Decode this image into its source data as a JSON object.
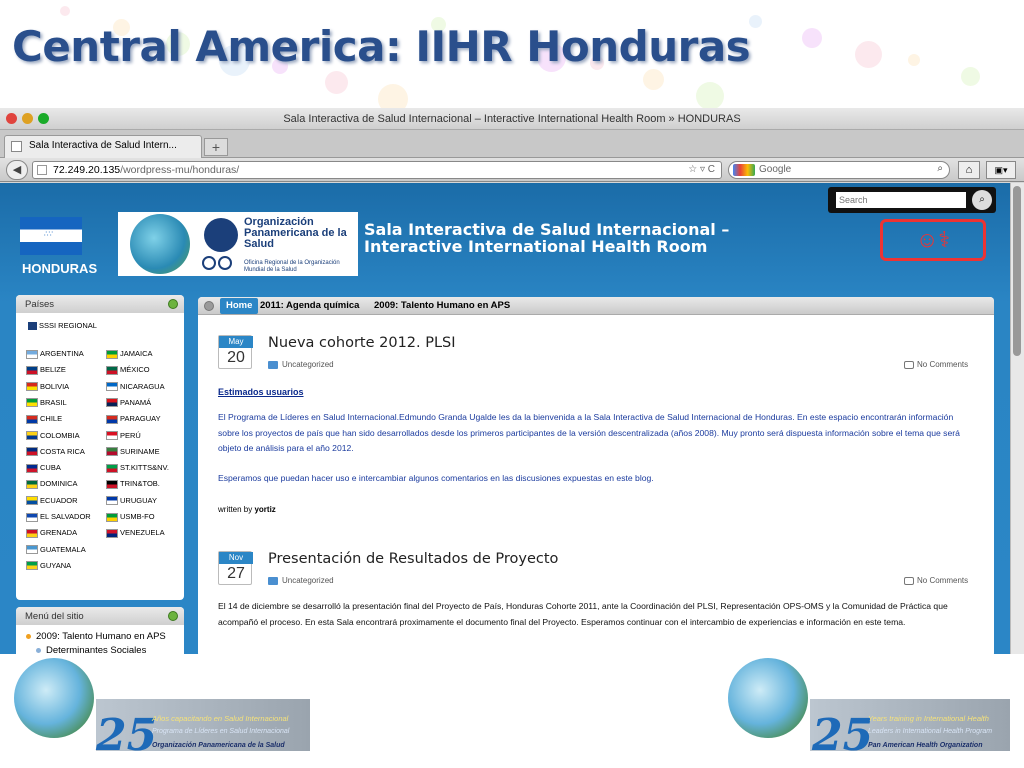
{
  "slide": {
    "title": "Central America: IIHR Honduras"
  },
  "window": {
    "title": "Sala Interactiva de Salud Internacional – Interactive International Health Room » HONDURAS",
    "tab_label": "Sala Interactiva de Salud Intern...",
    "new_tab_symbol": "+",
    "url_host": "72.249.20.135",
    "url_path": "/wordpress-mu/honduras/",
    "search_engine": "Google",
    "colors": {
      "close": "#e0443e",
      "minimize": "#dea123",
      "zoom": "#1aab29"
    }
  },
  "site": {
    "search_placeholder": "Search",
    "country_label": "HONDURAS",
    "ops_name": "Organización Panamericana de la Salud",
    "ops_sub": "Oficina Regional de la Organización Mundial de la Salud",
    "title_line1": "Sala Interactiva de Salud Internacional –",
    "title_line2": "Interactive International Health Room"
  },
  "sidebar": {
    "countries_header": "Países",
    "sssi": "SSSI REGIONAL",
    "countries_left": [
      "ARGENTINA",
      "BELIZE",
      "BOLIVIA",
      "BRASIL",
      "CHILE",
      "COLOMBIA",
      "COSTA RICA",
      "CUBA",
      "DOMINICA",
      "ECUADOR",
      "EL SALVADOR",
      "GRENADA",
      "GUATEMALA",
      "GUYANA"
    ],
    "countries_right": [
      "JAMAICA",
      "MÉXICO",
      "NICARAGUA",
      "PANAMÁ",
      "PARAGUAY",
      "PERÚ",
      "SURINAME",
      "ST.KITTS&NV.",
      "TRIN&TOB.",
      "URUGUAY",
      "USMB-FO",
      "VENEZUELA"
    ],
    "menu_header": "Menú del sitio",
    "menu_items": [
      "2009: Talento Humano en APS",
      "Determinantes Sociales"
    ]
  },
  "nav": {
    "home": "Home",
    "items": [
      "2011: Agenda química",
      "2009: Talento Humano en APS"
    ]
  },
  "posts": [
    {
      "month": "May",
      "day": "20",
      "title": "Nueva cohorte 2012. PLSI",
      "category": "Uncategorized",
      "comments": "No Comments",
      "greeting": "Estimados usuarios",
      "paragraph1": "El Programa de Líderes en Salud Internacional.Edmundo Granda Ugalde les da la bienvenida a la Sala Interactiva de Salud Internacional de Honduras. En este espacio encontrarán información sobre los proyectos de país que han sido desarrollados desde los primeros participantes de la versión descentralizada (años 2008). Muy pronto será dispuesta información sobre el tema que será objeto de análisis para el año 2012.",
      "paragraph2": "Esperamos que puedan hacer uso e intercambiar algunos comentarios en las discusiones expuestas en este blog.",
      "written_by": "written by",
      "author": "yortiz"
    },
    {
      "month": "Nov",
      "day": "27",
      "title": "Presentación de Resultados de Proyecto",
      "category": "Uncategorized",
      "comments": "No Comments",
      "paragraph1": "El 14 de diciembre se desarrolló la presentación final del Proyecto de País, Honduras Cohorte 2011, ante la Coordinación del PLSI, Representación OPS-OMS y la Comunidad de Práctica que acompañó el proceso. En esta Sala encontrará proximamente el documento final del Proyecto. Esperamos continuar con el intercambio de experiencias e información en este tema."
    }
  ],
  "footer": {
    "number": "25",
    "left_line1": "Años capacitando en Salud Internacional",
    "left_line2": "Programa de Líderes en Salud Internacional",
    "left_line3": "Organización Panamericana de la Salud",
    "right_line1": "Years training in International Health",
    "right_line2": "Leaders in International Health Program",
    "right_line3": "Pan American Health Organization"
  }
}
